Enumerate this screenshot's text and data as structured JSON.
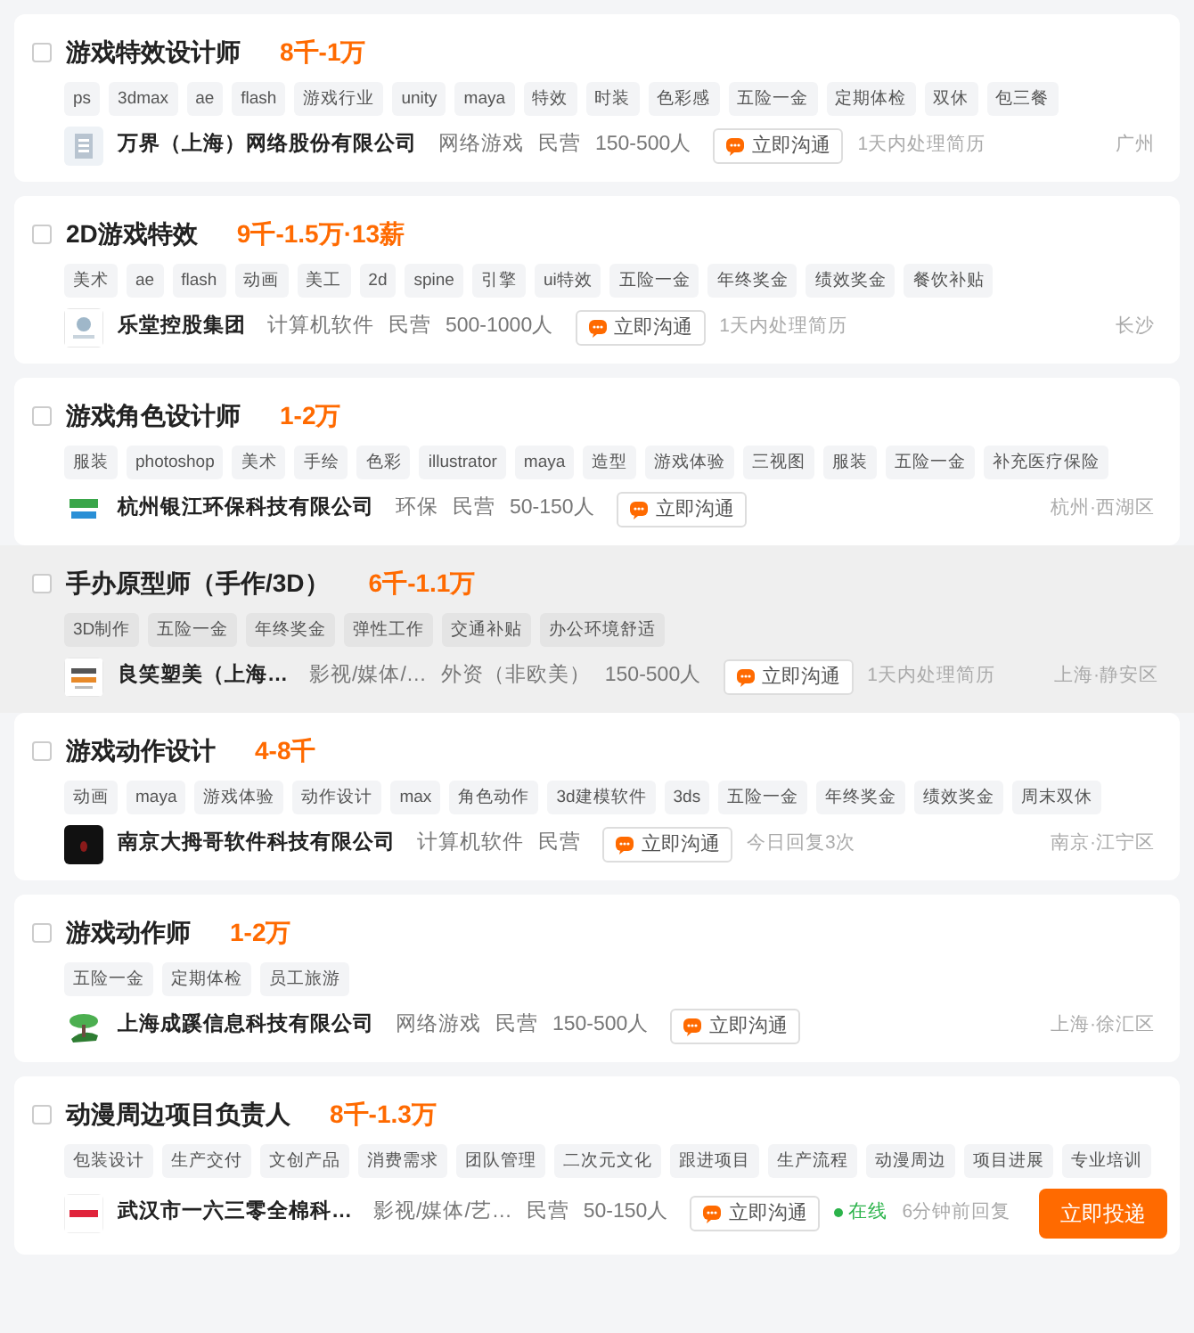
{
  "jobs": [
    {
      "checked": false,
      "highlighted": false,
      "title": "游戏特效设计师",
      "salary": "8千-1万",
      "tags": [
        "ps",
        "3dmax",
        "ae",
        "flash",
        "游戏行业",
        "unity",
        "maya",
        "特效",
        "时装",
        "色彩感",
        "五险一金",
        "定期体检",
        "双休",
        "包三餐"
      ],
      "logo": {
        "kind": "building"
      },
      "company": "万界（上海）网络股份有限公司",
      "meta": [
        "网络游戏",
        "民营",
        "150-500人"
      ],
      "chat": "立即沟通",
      "reply": "1天内处理简历",
      "location": "广州"
    },
    {
      "checked": false,
      "highlighted": false,
      "title": "2D游戏特效",
      "salary": "9千-1.5万·13薪",
      "tags": [
        "美术",
        "ae",
        "flash",
        "动画",
        "美工",
        "2d",
        "spine",
        "引擎",
        "ui特效",
        "五险一金",
        "年终奖金",
        "绩效奖金",
        "餐饮补贴"
      ],
      "logo": {
        "kind": "plain"
      },
      "company": "乐堂控股集团",
      "meta": [
        "计算机软件",
        "民营",
        "500-1000人"
      ],
      "chat": "立即沟通",
      "reply": "1天内处理简历",
      "location": "长沙"
    },
    {
      "checked": false,
      "highlighted": false,
      "title": "游戏角色设计师",
      "salary": "1-2万",
      "tags": [
        "服装",
        "photoshop",
        "美术",
        "手绘",
        "色彩",
        "illustrator",
        "maya",
        "造型",
        "游戏体验",
        "三视图",
        "服装",
        "五险一金",
        "补充医疗保险"
      ],
      "logo": {
        "kind": "green"
      },
      "company": "杭州银江环保科技有限公司",
      "meta": [
        "环保",
        "民营",
        "50-150人"
      ],
      "chat": "立即沟通",
      "location": "杭州·西湖区"
    },
    {
      "checked": false,
      "highlighted": true,
      "title": "手办原型师（手作/3D）",
      "salary": "6千-1.1万",
      "tags": [
        "3D制作",
        "五险一金",
        "年终奖金",
        "弹性工作",
        "交通补贴",
        "办公环境舒适"
      ],
      "logo": {
        "kind": "smile"
      },
      "company": "良笑塑美（上海…",
      "meta": [
        "影视/媒体/…",
        "外资（非欧美）",
        "150-500人"
      ],
      "chat": "立即沟通",
      "reply": "1天内处理简历",
      "location": "上海·静安区"
    },
    {
      "checked": false,
      "highlighted": false,
      "title": "游戏动作设计",
      "salary": "4-8千",
      "tags": [
        "动画",
        "maya",
        "游戏体验",
        "动作设计",
        "max",
        "角色动作",
        "3d建模软件",
        "3ds",
        "五险一金",
        "年终奖金",
        "绩效奖金",
        "周末双休"
      ],
      "logo": {
        "kind": "dark"
      },
      "company": "南京大拇哥软件科技有限公司",
      "meta": [
        "计算机软件",
        "民营"
      ],
      "chat": "立即沟通",
      "reply": "今日回复3次",
      "location": "南京·江宁区"
    },
    {
      "checked": false,
      "highlighted": false,
      "title": "游戏动作师",
      "salary": "1-2万",
      "tags": [
        "五险一金",
        "定期体检",
        "员工旅游"
      ],
      "logo": {
        "kind": "tree"
      },
      "company": "上海成蹊信息科技有限公司",
      "meta": [
        "网络游戏",
        "民营",
        "150-500人"
      ],
      "chat": "立即沟通",
      "location": "上海·徐汇区"
    },
    {
      "checked": false,
      "highlighted": false,
      "title": "动漫周边项目负责人",
      "salary": "8千-1.3万",
      "tags": [
        "包装设计",
        "生产交付",
        "文创产品",
        "消费需求",
        "团队管理",
        "二次元文化",
        "跟进项目",
        "生产流程",
        "动漫周边",
        "项目进展",
        "专业培训"
      ],
      "logo": {
        "kind": "red"
      },
      "company": "武汉市一六三零全棉科…",
      "meta": [
        "影视/媒体/艺…",
        "民营",
        "50-150人"
      ],
      "chat": "立即沟通",
      "online": "在线",
      "reply": "6分钟前回复",
      "apply": "立即投递"
    }
  ]
}
